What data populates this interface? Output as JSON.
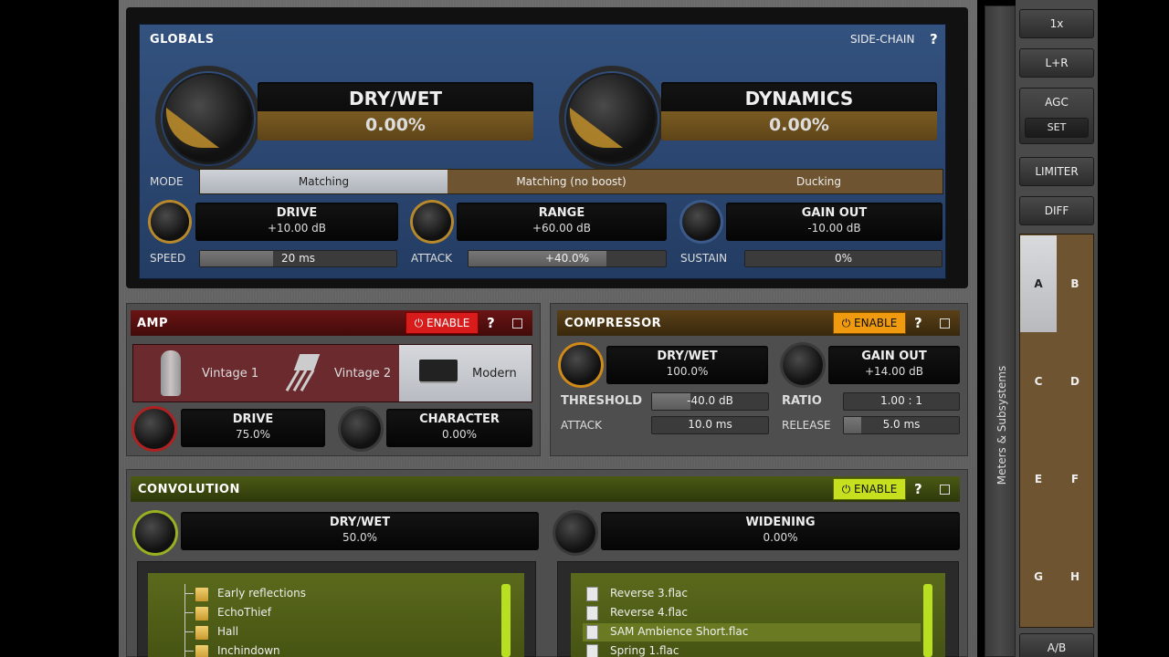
{
  "globals": {
    "title": "GLOBALS",
    "sidechain": "SIDE-CHAIN",
    "help": "?",
    "drywet": {
      "label": "DRY/WET",
      "value": "0.00%"
    },
    "dynamics": {
      "label": "DYNAMICS",
      "value": "0.00%"
    },
    "mode_label": "MODE",
    "modes": [
      "Matching",
      "Matching (no boost)",
      "Ducking"
    ],
    "drive": {
      "label": "DRIVE",
      "value": "+10.00 dB"
    },
    "range": {
      "label": "RANGE",
      "value": "+60.00 dB"
    },
    "gain_out": {
      "label": "GAIN OUT",
      "value": "-10.00 dB"
    },
    "speed": {
      "label": "SPEED",
      "value": "20 ms",
      "level": 0.37
    },
    "attack": {
      "label": "ATTACK",
      "value": "+40.0%",
      "level": 0.7
    },
    "sustain": {
      "label": "SUSTAIN",
      "value": "0%",
      "level": 0.0
    }
  },
  "amp": {
    "title": "AMP",
    "enable": "ENABLE",
    "help": "?",
    "types": [
      "Vintage 1",
      "Vintage 2",
      "Modern"
    ],
    "selected": "Modern",
    "drive": {
      "label": "DRIVE",
      "value": "75.0%"
    },
    "character": {
      "label": "CHARACTER",
      "value": "0.00%"
    }
  },
  "compressor": {
    "title": "COMPRESSOR",
    "enable": "ENABLE",
    "help": "?",
    "drywet": {
      "label": "DRY/WET",
      "value": "100.0%"
    },
    "gain_out": {
      "label": "GAIN OUT",
      "value": "+14.00 dB"
    },
    "threshold": {
      "label": "THRESHOLD",
      "value": "-40.0 dB",
      "level": 0.33
    },
    "ratio": {
      "label": "RATIO",
      "value": "1.00 : 1",
      "level": 0.0
    },
    "attack": {
      "label": "ATTACK",
      "value": "10.0 ms",
      "level": 0.0
    },
    "release": {
      "label": "RELEASE",
      "value": "5.0 ms",
      "level": 0.15
    }
  },
  "convolution": {
    "title": "CONVOLUTION",
    "enable": "ENABLE",
    "help": "?",
    "drywet": {
      "label": "DRY/WET",
      "value": "50.0%"
    },
    "widening": {
      "label": "WIDENING",
      "value": "0.00%"
    },
    "folders": [
      "Early reflections",
      "EchoThief",
      "Hall",
      "Inchindown"
    ],
    "files": [
      "Reverse 3.flac",
      "Reverse 4.flac",
      "SAM Ambience Short.flac",
      "Spring 1.flac"
    ],
    "selected_file": "SAM Ambience Short.flac"
  },
  "sidebar": {
    "vertical_label": "Meters & Subsystems",
    "zoom": "1x",
    "channel": "L+R",
    "agc": "AGC",
    "set": "SET",
    "limiter": "LIMITER",
    "diff": "DIFF",
    "presets": [
      "A",
      "B",
      "C",
      "D",
      "E",
      "F",
      "G",
      "H"
    ],
    "selected_preset": "A",
    "ab": "A/B"
  },
  "colors": {
    "globals_bg": "#2b4672",
    "amp_header": "#5a1010",
    "amp_enable": "#d81c1c",
    "comp_header": "#4a3414",
    "comp_enable": "#f09a10",
    "conv_header": "#3c4a10",
    "conv_enable": "#c6e020",
    "bronze": "#6e5430"
  }
}
